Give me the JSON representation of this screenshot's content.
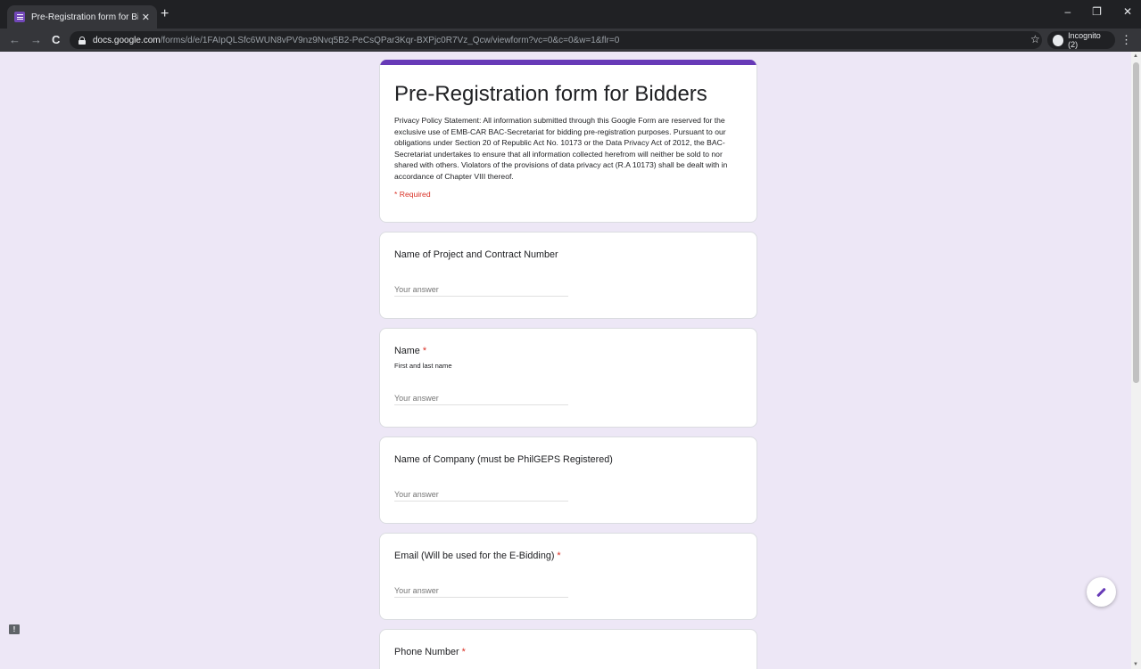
{
  "browser": {
    "tab_title": "Pre-Registration form for Bidders",
    "tab_close": "✕",
    "new_tab": "+",
    "url_host": "docs.google.com",
    "url_path": "/forms/d/e/1FAIpQLSfc6WUN8vPV9nz9Nvq5B2-PeCsQPar3Kqr-BXPjc0R7Vz_Qcw/viewform?vc=0&c=0&w=1&flr=0",
    "incognito_label": "Incognito (2)",
    "back": "←",
    "forward": "→",
    "reload": "C",
    "star": "☆",
    "menu": "⋮",
    "minimize": "–",
    "restore": "❐",
    "close": "✕"
  },
  "form": {
    "accent_color": "#673ab7",
    "title": "Pre-Registration form for Bidders",
    "description": "Privacy Policy Statement: All information submitted through this Google Form are reserved for the exclusive use of EMB-CAR BAC-Secretariat for bidding pre-registration purposes. Pursuant to our obligations under Section 20 of Republic Act No. 10173 or the Data Privacy Act of 2012, the BAC-Secretariat undertakes to ensure that all information collected herefrom will neither be sold to nor shared with others. Violators of the provisions of data privacy act  (R.A 10173) shall be dealt with in accordance of Chapter VIII thereof.",
    "required_note": "* Required",
    "questions": [
      {
        "label": "Name of Project and Contract Number",
        "required": "",
        "help": "",
        "placeholder": "Your answer"
      },
      {
        "label": "Name",
        "required": "*",
        "help": "First and last name",
        "placeholder": "Your answer"
      },
      {
        "label": "Name of Company (must be PhilGEPS Registered)",
        "required": "",
        "help": "",
        "placeholder": "Your answer"
      },
      {
        "label": "Email (Will be used for the E-Bidding)",
        "required": "*",
        "help": "",
        "placeholder": "Your answer"
      },
      {
        "label": "Phone Number",
        "required": "*",
        "help": "",
        "placeholder": ""
      }
    ]
  },
  "feedback_icon": "!",
  "icons": [
    "lock-icon",
    "incognito-icon",
    "pencil-icon",
    "feedback-icon"
  ]
}
